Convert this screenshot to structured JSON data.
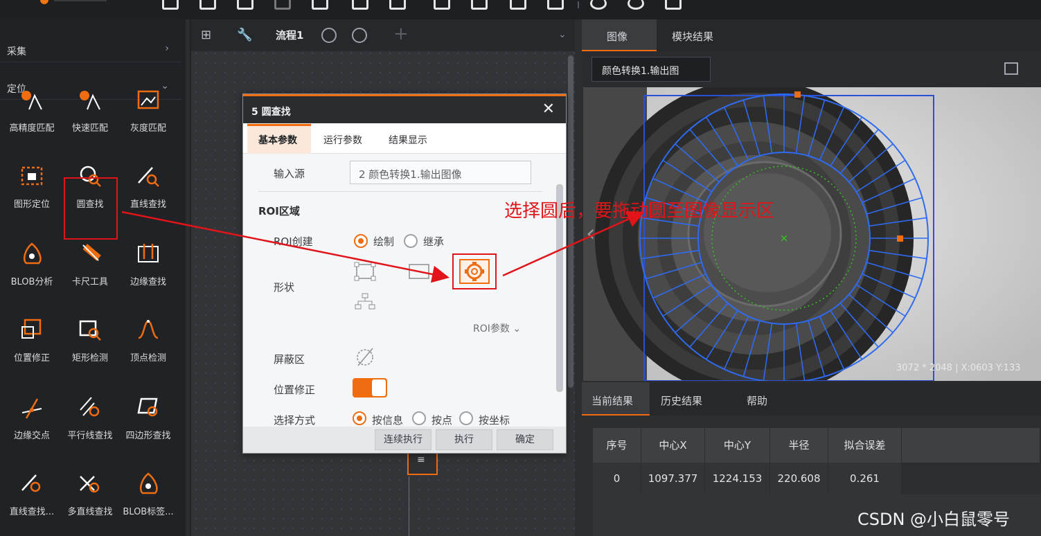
{
  "left_panel": {
    "categories": [
      {
        "label": "采集",
        "arrow": "›"
      },
      {
        "label": "定位",
        "arrow": "⌄"
      }
    ],
    "tools": [
      {
        "label": "高精度匹配",
        "icon": "high-precision-match-icon"
      },
      {
        "label": "快速匹配",
        "icon": "fast-match-icon"
      },
      {
        "label": "灰度匹配",
        "icon": "gray-match-icon"
      },
      {
        "label": "图形定位",
        "icon": "shape-locate-icon"
      },
      {
        "label": "圆查找",
        "icon": "circle-find-icon"
      },
      {
        "label": "直线查找",
        "icon": "line-find-icon"
      },
      {
        "label": "BLOB分析",
        "icon": "blob-analysis-icon"
      },
      {
        "label": "卡尺工具",
        "icon": "caliper-icon"
      },
      {
        "label": "边缘查找",
        "icon": "edge-find-icon"
      },
      {
        "label": "位置修正",
        "icon": "position-correct-icon"
      },
      {
        "label": "矩形检测",
        "icon": "rect-detect-icon"
      },
      {
        "label": "顶点检测",
        "icon": "vertex-detect-icon"
      },
      {
        "label": "边缘交点",
        "icon": "edge-intersection-icon"
      },
      {
        "label": "平行线查找",
        "icon": "parallel-line-icon"
      },
      {
        "label": "四边形查找",
        "icon": "quad-find-icon"
      },
      {
        "label": "直线查找...",
        "icon": "line-find-2-icon"
      },
      {
        "label": "多直线查找",
        "icon": "multi-line-icon"
      },
      {
        "label": "BLOB标签...",
        "icon": "blob-label-icon"
      }
    ]
  },
  "flow": {
    "name": "流程1",
    "add": "+",
    "node_icon": "≡"
  },
  "dialog": {
    "title": "5 圆查找",
    "close": "✕",
    "tabs": [
      "基本参数",
      "运行参数",
      "结果显示"
    ],
    "input_source_label": "输入源",
    "input_source_value": "2 颜色转换1.输出图像",
    "roi_section": "ROI区域",
    "roi_create_label": "ROI创建",
    "roi_create_options": [
      "绘制",
      "继承"
    ],
    "shape_label": "形状",
    "roi_param": "ROI参数 ⌄",
    "mask_label": "屏蔽区",
    "position_correct_label": "位置修正",
    "select_mode_label": "选择方式",
    "select_mode_options": [
      "按信息",
      "按点",
      "按坐标"
    ],
    "buttons": [
      "连续执行",
      "执行",
      "确定"
    ]
  },
  "right_panel": {
    "tabs": [
      "图像",
      "模块结果"
    ],
    "image_source": "颜色转换1.输出图",
    "status": "3072 * 2048  |  X:0603  Y:133",
    "bottom_tabs": [
      "当前结果",
      "历史结果",
      "帮助"
    ],
    "table": {
      "headers": [
        "序号",
        "中心X",
        "中心Y",
        "半径",
        "拟合误差"
      ],
      "rows": [
        [
          "0",
          "1097.377",
          "1224.153",
          "220.608",
          "0.261"
        ]
      ]
    }
  },
  "annotation": "选择圆后，要拖动圆至图像显示区",
  "watermark": "CSDN @小白鼠零号",
  "colors": {
    "accent": "#ef6d10",
    "annotation": "#e1141a",
    "roi": "#1f5fe0",
    "fit": "#35c41f"
  }
}
